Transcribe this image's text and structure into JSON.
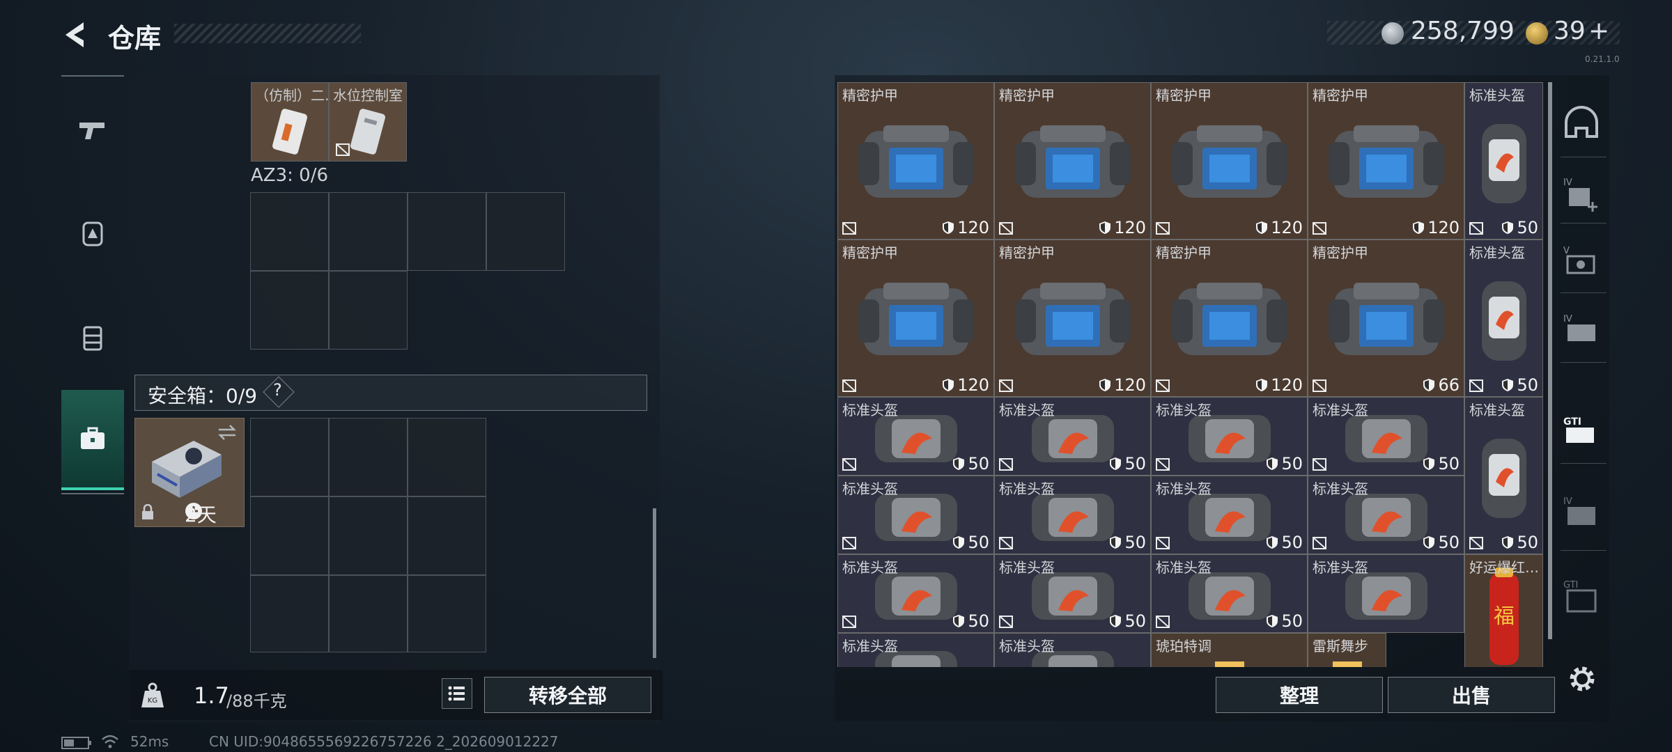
{
  "header": {
    "title": "仓库",
    "money": "258,799",
    "gold": "39",
    "plus": "+",
    "version": "0.21.1.0"
  },
  "left_tabs": [
    {
      "name": "weapons",
      "icon": "pistol-icon"
    },
    {
      "name": "equipment",
      "icon": "backpack-icon"
    },
    {
      "name": "vest",
      "icon": "vest-icon"
    },
    {
      "name": "tools",
      "icon": "toolbox-icon",
      "selected": true
    }
  ],
  "left_panel": {
    "top_items": [
      "（仿制）二…",
      "水位控制室"
    ],
    "az3_label": "AZ3: 0/6",
    "safe_label": "安全箱：0/9",
    "safe_help": "?",
    "safe_timer": "2天"
  },
  "weight": {
    "current": "1.7",
    "max": "/88千克"
  },
  "transfer_all": "转移全部",
  "sort_label": "整理",
  "sell_label": "出售",
  "status": {
    "ping": "52ms",
    "uid": "CN UID:9048655569226757226 2_202609012227"
  },
  "items": [
    {
      "name": "精密护甲",
      "durability": "120",
      "kind": "armor"
    },
    {
      "name": "精密护甲",
      "durability": "120",
      "kind": "armor"
    },
    {
      "name": "精密护甲",
      "durability": "120",
      "kind": "armor"
    },
    {
      "name": "精密护甲",
      "durability": "120",
      "kind": "armor"
    },
    {
      "name": "标准头盔",
      "durability": "50",
      "kind": "helmet"
    },
    {
      "name": "精密护甲",
      "durability": "120",
      "kind": "armor"
    },
    {
      "name": "精密护甲",
      "durability": "120",
      "kind": "armor"
    },
    {
      "name": "精密护甲",
      "durability": "120",
      "kind": "armor"
    },
    {
      "name": "精密护甲",
      "durability": "66",
      "kind": "armor"
    },
    {
      "name": "标准头盔",
      "durability": "50",
      "kind": "helmet"
    },
    {
      "name": "标准头盔",
      "durability": "50",
      "kind": "helmet"
    },
    {
      "name": "标准头盔",
      "durability": "50",
      "kind": "helmet"
    },
    {
      "name": "标准头盔",
      "durability": "50",
      "kind": "helmet"
    },
    {
      "name": "标准头盔",
      "durability": "50",
      "kind": "helmet"
    },
    {
      "name": "标准头盔",
      "durability": "50",
      "kind": "helmet"
    },
    {
      "name": "标准头盔",
      "durability": "50",
      "kind": "helmet"
    },
    {
      "name": "标准头盔",
      "durability": "50",
      "kind": "helmet"
    },
    {
      "name": "标准头盔",
      "durability": "50",
      "kind": "helmet"
    },
    {
      "name": "标准头盔",
      "durability": "50",
      "kind": "helmet"
    },
    {
      "name": "标准头盔",
      "durability": "50",
      "kind": "helmet"
    },
    {
      "name": "标准头盔",
      "durability": "50",
      "kind": "helmet"
    },
    {
      "name": "标准头盔",
      "durability": "50",
      "kind": "helmet"
    },
    {
      "name": "好运爆红…",
      "durability": "",
      "kind": "fire"
    },
    {
      "name": "标准头盔",
      "durability": "",
      "kind": "helmet"
    },
    {
      "name": "标准头盔",
      "durability": "",
      "kind": "helmet"
    },
    {
      "name": "标准头盔",
      "durability": "",
      "kind": "helmet"
    },
    {
      "name": "琥珀特调",
      "durability": "",
      "kind": "fire"
    },
    {
      "name": "雷斯舞步",
      "durability": "",
      "kind": "fire"
    }
  ],
  "right_tabs": [
    "helmet-slot-icon",
    "level4-add-icon",
    "level5-icon",
    "level4-vest-icon",
    "gti-icon",
    "level4-rig-icon",
    "gti2-icon"
  ]
}
